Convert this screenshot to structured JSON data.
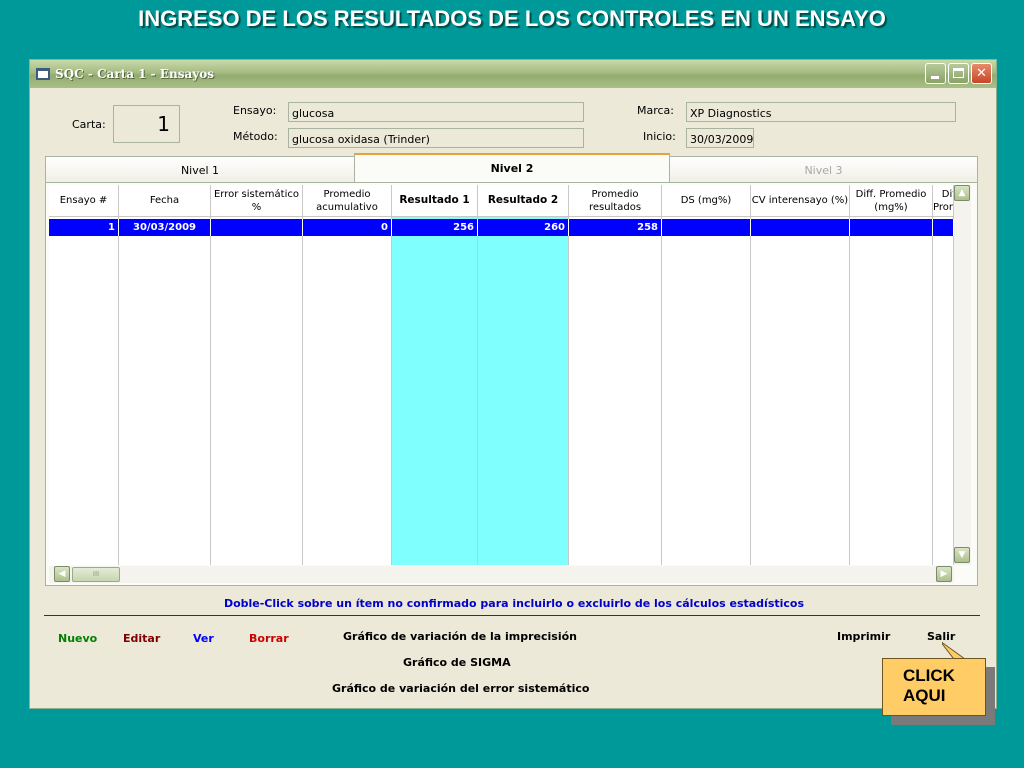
{
  "slide": {
    "title": "INGRESO DE LOS RESULTADOS DE LOS CONTROLES EN UN ENSAYO"
  },
  "window": {
    "title": "SQC - Carta 1 - Ensayos",
    "controls": [
      "minimize",
      "maximize",
      "close"
    ]
  },
  "form": {
    "carta_label": "Carta:",
    "carta_value": "1",
    "ensayo_label": "Ensayo:",
    "ensayo_value": "glucosa",
    "metodo_label": "Método:",
    "metodo_value": "glucosa oxidasa (Trinder)",
    "marca_label": "Marca:",
    "marca_value": "XP Diagnostics",
    "inicio_label": "Inicio:",
    "inicio_value": "30/03/2009"
  },
  "tabs": [
    {
      "label": "Nivel 1",
      "state": "normal"
    },
    {
      "label": "Nivel 2",
      "state": "active"
    },
    {
      "label": "Nivel 3",
      "state": "disabled"
    }
  ],
  "table": {
    "columns": [
      {
        "label": "Ensayo #"
      },
      {
        "label": "Fecha"
      },
      {
        "label": "Error sistemático %"
      },
      {
        "label": "Promedio acumulativo"
      },
      {
        "label": "Resultado 1"
      },
      {
        "label": "Resultado 2"
      },
      {
        "label": "Promedio resultados"
      },
      {
        "label": "DS (mg%)"
      },
      {
        "label": "CV interensayo (%)"
      },
      {
        "label": "Diff. Promedio (mg%)"
      },
      {
        "label": "Diff. Promed"
      }
    ],
    "rows": [
      {
        "ensayo": "1",
        "fecha": "30/03/2009",
        "error": "",
        "promedio_acum": "0",
        "resultado1": "256",
        "resultado2": "260",
        "promedio_res": "258",
        "ds": "",
        "cv": "",
        "diff": "",
        "diff2": ""
      }
    ],
    "selected_row_color": "#0000ff",
    "highlight_column_color": "#80ffff"
  },
  "hint": "Doble-Click sobre un ítem no confirmado para incluirlo o excluirlo de los cálculos estadísticos",
  "actions": {
    "nuevo": "Nuevo",
    "editar": "Editar",
    "ver": "Ver",
    "borrar": "Borrar",
    "grafico_imprecision": "Gráfico de variación de la imprecisión",
    "grafico_sigma": "Gráfico de SIGMA",
    "grafico_error": "Gráfico de variación del error sistemático",
    "imprimir": "Imprimir",
    "salir": "Salir"
  },
  "action_colors": {
    "nuevo": "#008000",
    "editar": "#800000",
    "ver": "#0000ff",
    "borrar": "#cc0000"
  },
  "callout": {
    "line1": "CLICK",
    "line2": "AQUI",
    "color": "#ffcc66"
  },
  "icons": {
    "app": "window-icon",
    "scroll_up": "arrow-up-icon",
    "scroll_down": "arrow-down-icon",
    "scroll_left": "arrow-left-icon",
    "scroll_right": "arrow-right-icon"
  }
}
